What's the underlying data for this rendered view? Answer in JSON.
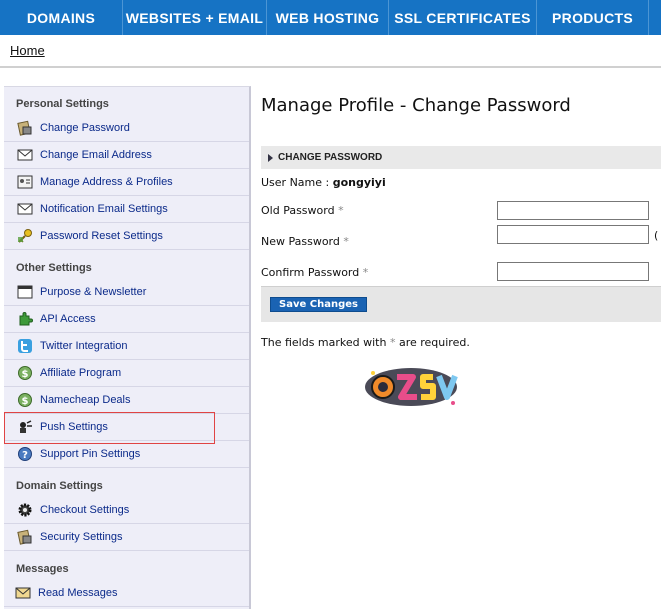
{
  "topnav": {
    "items": [
      "DOMAINS",
      "WEBSITES + EMAIL",
      "WEB HOSTING",
      "SSL CERTIFICATES",
      "PRODUCTS",
      ""
    ]
  },
  "breadcrumb": {
    "home": "Home"
  },
  "sidebar": {
    "sections": [
      {
        "title": "Personal Settings",
        "items": [
          {
            "label": "Change Password",
            "icon": "lock-icon"
          },
          {
            "label": "Change Email Address",
            "icon": "envelope-icon"
          },
          {
            "label": "Manage Address & Profiles",
            "icon": "address-card-icon"
          },
          {
            "label": "Notification Email Settings",
            "icon": "envelope-icon"
          },
          {
            "label": "Password Reset Settings",
            "icon": "key-icon"
          }
        ]
      },
      {
        "title": "Other Settings",
        "items": [
          {
            "label": "Purpose & Newsletter",
            "icon": "window-icon"
          },
          {
            "label": "API Access",
            "icon": "puzzle-icon"
          },
          {
            "label": "Twitter Integration",
            "icon": "twitter-icon"
          },
          {
            "label": "Affiliate Program",
            "icon": "dollar-icon"
          },
          {
            "label": "Namecheap Deals",
            "icon": "dollar-icon"
          },
          {
            "label": "Push Settings",
            "icon": "push-icon"
          },
          {
            "label": "Support Pin Settings",
            "icon": "support-icon"
          }
        ]
      },
      {
        "title": "Domain Settings",
        "items": [
          {
            "label": "Checkout Settings",
            "icon": "gear-icon"
          },
          {
            "label": "Security Settings",
            "icon": "shield-icon"
          }
        ]
      },
      {
        "title": "Messages",
        "items": [
          {
            "label": "Read Messages",
            "icon": "envelope-icon"
          }
        ]
      }
    ]
  },
  "main": {
    "page_title": "Manage Profile - Change Password",
    "section_bar": "CHANGE PASSWORD",
    "username_label": "User Name : ",
    "username_value": "gongyiyi",
    "old_password_label": "Old Password",
    "new_password_label": "New Password",
    "confirm_password_label": "Confirm Password",
    "required_mark": "*",
    "new_password_hint": "(",
    "save_button": "Save Changes",
    "note_before": "The fields marked with ",
    "note_after": " are required."
  },
  "colors": {
    "nav_bg": "#1673c4",
    "sidebar_bg": "#eeeef8",
    "link": "#0b2a8a",
    "button": "#1a63b3",
    "highlight_border": "#e04444"
  }
}
